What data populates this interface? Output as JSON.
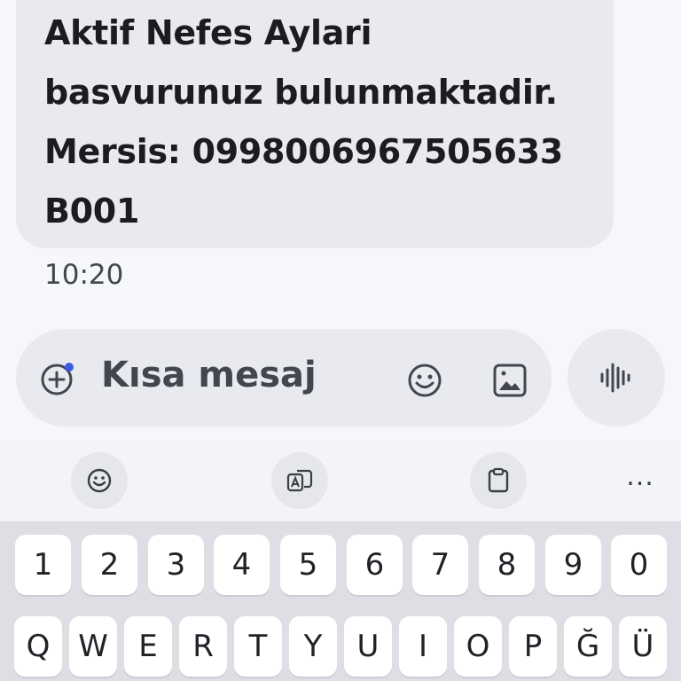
{
  "message": {
    "lines": [
      "Aktif Nefes Aylari",
      "basvurunuz bulunmaktadir.",
      "Mersis: 0998006967505633",
      "B001"
    ],
    "time": "10:20"
  },
  "composer": {
    "placeholder": "Kısa mesaj"
  },
  "keyboard": {
    "more_label": "...",
    "number_row": [
      "1",
      "2",
      "3",
      "4",
      "5",
      "6",
      "7",
      "8",
      "9",
      "0"
    ],
    "letter_row": [
      "Q",
      "W",
      "E",
      "R",
      "T",
      "Y",
      "U",
      "I",
      "O",
      "P",
      "Ğ",
      "Ü"
    ]
  },
  "colors": {
    "accent": "#3b5bdb",
    "bubble": "#e9eaf0",
    "keyboard_bg": "#dddfe5"
  }
}
